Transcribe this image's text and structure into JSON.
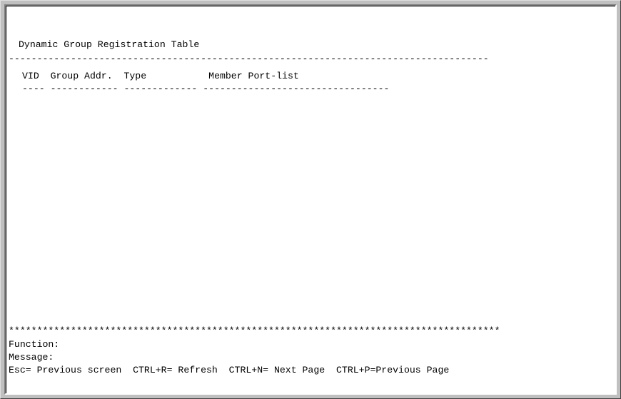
{
  "screen": {
    "title": "Dynamic Group Registration Table",
    "separator_dash": "-------------------------------------------------------------------------------------",
    "table": {
      "columns": [
        "VID",
        "Group Addr.",
        "Type",
        "Member Port-list"
      ],
      "header_line": "VID  Group Addr.  Type           Member Port-list",
      "underline": "---- ------------ ------------- ---------------------------------",
      "rows": []
    },
    "separator_star": "***************************************************************************************",
    "function_label": "Function:",
    "message_label": "Message:",
    "hotkeys": [
      "Esc= Previous screen",
      "CTRL+R= Refresh",
      "CTRL+N= Next Page",
      "CTRL+P=Previous Page"
    ],
    "hotkey_line": "Esc= Previous screen  CTRL+R= Refresh  CTRL+N= Next Page  CTRL+P=Previous Page"
  }
}
